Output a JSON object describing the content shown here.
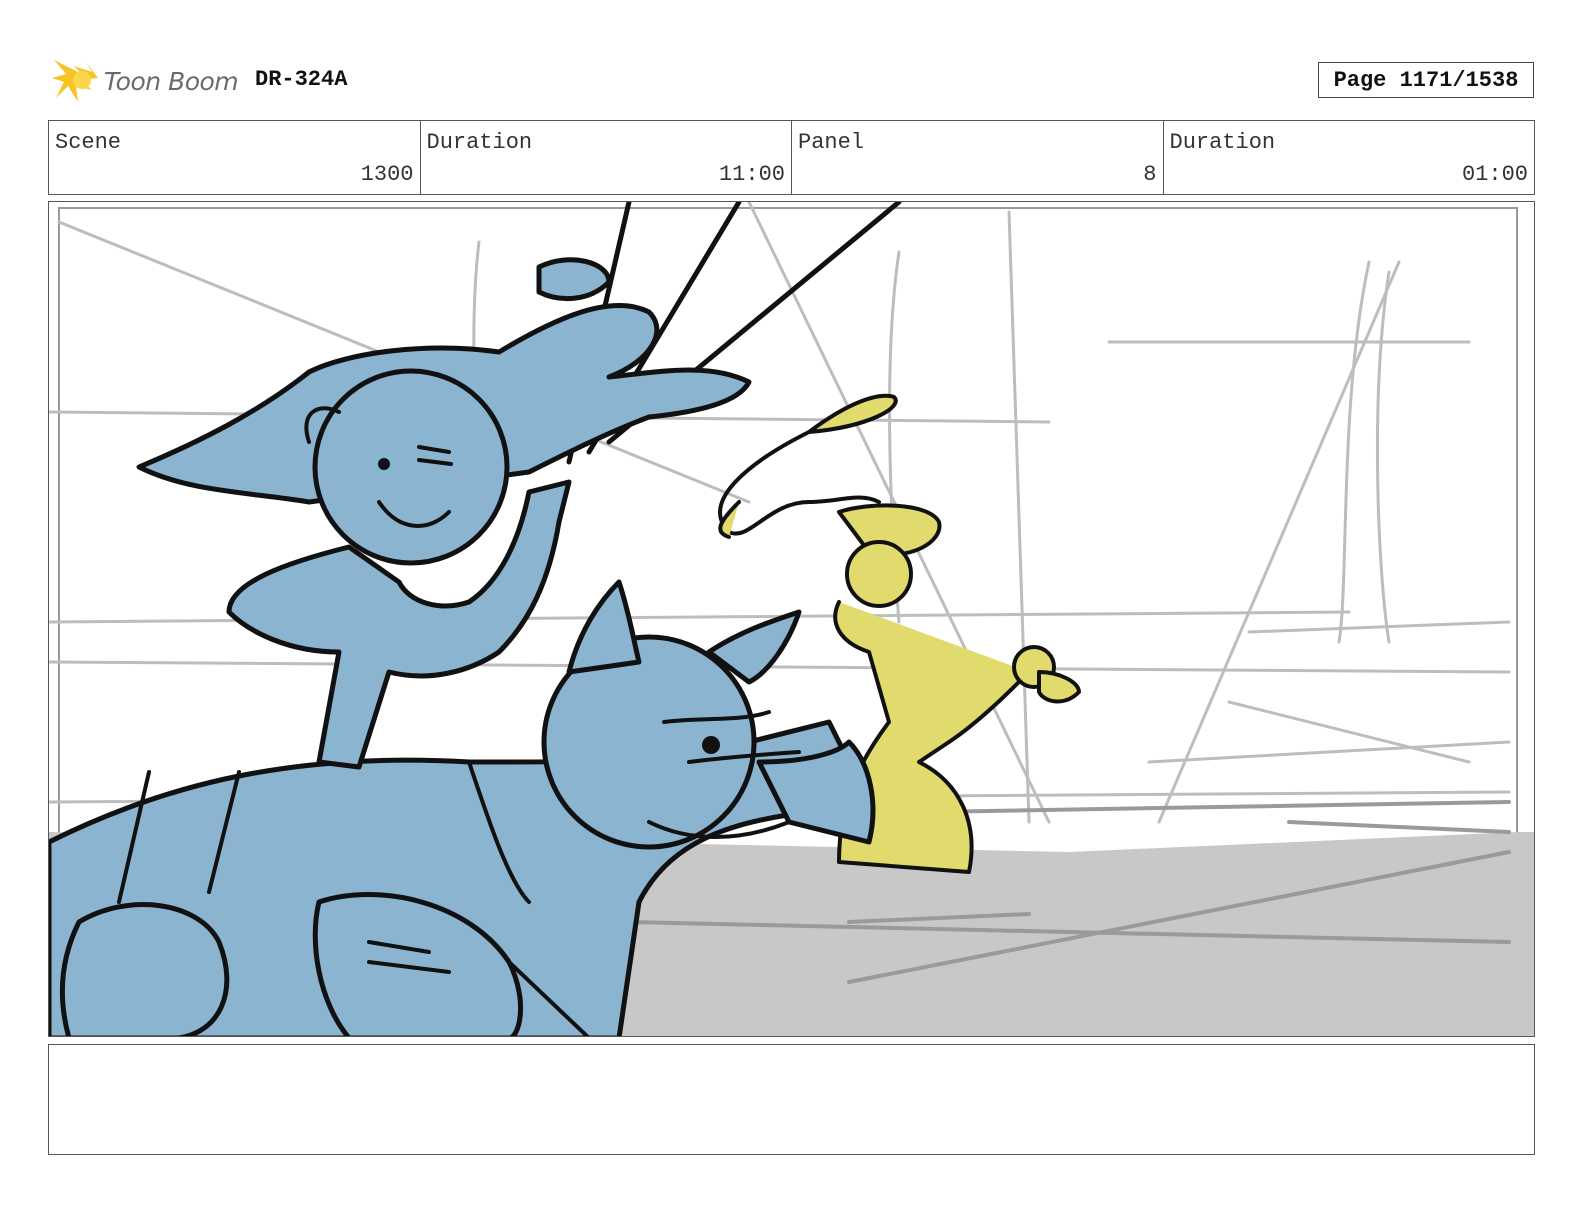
{
  "header": {
    "logo_text": "Toon Boom",
    "doc_code": "DR-324A",
    "page_label": "Page 1171/1538"
  },
  "info": {
    "scene_label": "Scene",
    "scene_value": "1300",
    "scene_duration_label": "Duration",
    "scene_duration_value": "11:00",
    "panel_label": "Panel",
    "panel_value": "8",
    "panel_duration_label": "Duration",
    "panel_duration_value": "01:00"
  },
  "colors": {
    "blue_fill": "#8ab4cf",
    "yellow_fill": "#e0db6c",
    "ground_grey": "#c8c8c8",
    "logo_yellow": "#f6c423"
  },
  "notes": {
    "text": ""
  }
}
